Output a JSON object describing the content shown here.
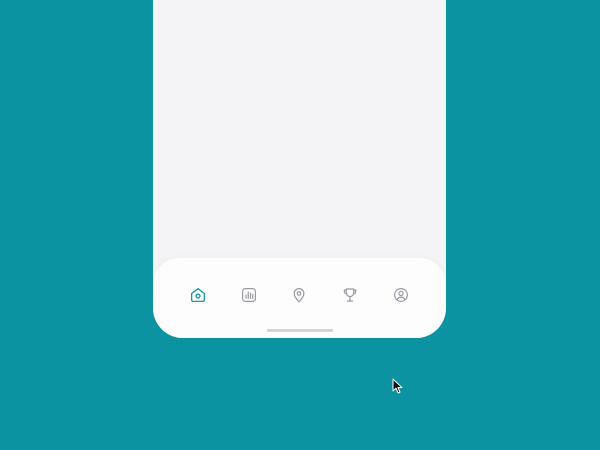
{
  "colors": {
    "background": "#0B93A1",
    "screen": "#F4F4F7",
    "tabbar": "#FDFDFE",
    "active_icon": "#1597A2",
    "inactive_icon": "#9A9AA3",
    "home_indicator": "#D4D4D8"
  },
  "tabbar": {
    "active_tab": "home",
    "items": [
      {
        "id": "home",
        "icon": "home-icon",
        "active": true
      },
      {
        "id": "stats",
        "icon": "bar-chart-icon",
        "active": false
      },
      {
        "id": "map",
        "icon": "map-pin-icon",
        "active": false
      },
      {
        "id": "trophy",
        "icon": "trophy-icon",
        "active": false
      },
      {
        "id": "profile",
        "icon": "user-circle-icon",
        "active": false
      }
    ]
  }
}
